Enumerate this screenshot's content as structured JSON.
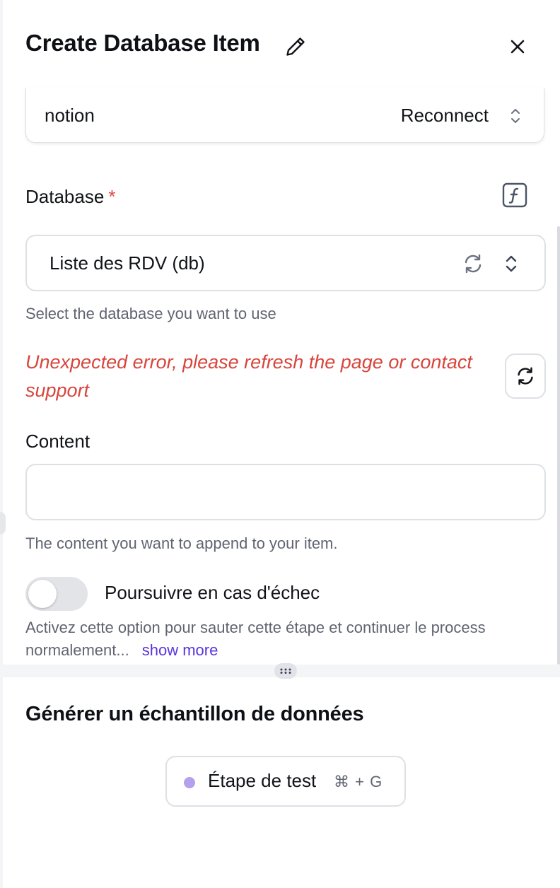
{
  "header": {
    "title": "Create Database Item"
  },
  "connection": {
    "name": "notion",
    "reconnect_label": "Reconnect"
  },
  "database": {
    "label": "Database",
    "required_mark": "*",
    "selected": "Liste des RDV (db)",
    "help": "Select the database you want to use"
  },
  "error": {
    "message": "Unexpected error, please refresh the page or contact support"
  },
  "content": {
    "label": "Content",
    "value": "",
    "help": "The content you want to append to your item."
  },
  "continue_on_failure": {
    "label": "Poursuivre en cas d'échec",
    "enabled": false,
    "description": "Activez cette option pour sauter cette étape et continuer le process normalement...",
    "show_more": "show more"
  },
  "sample": {
    "title": "Générer un échantillon de données",
    "test_button": {
      "label": "Étape de test",
      "shortcut": "⌘ + G"
    }
  },
  "colors": {
    "error": "#d8453c",
    "required": "#e04848",
    "link": "#5b34da",
    "test_dot": "#b4a0ec",
    "border": "#dde0e5"
  },
  "icons": [
    "edit-pencil-icon",
    "close-icon",
    "chevron-up-down-icon",
    "formula-icon",
    "refresh-icon",
    "drag-handle-icon"
  ]
}
